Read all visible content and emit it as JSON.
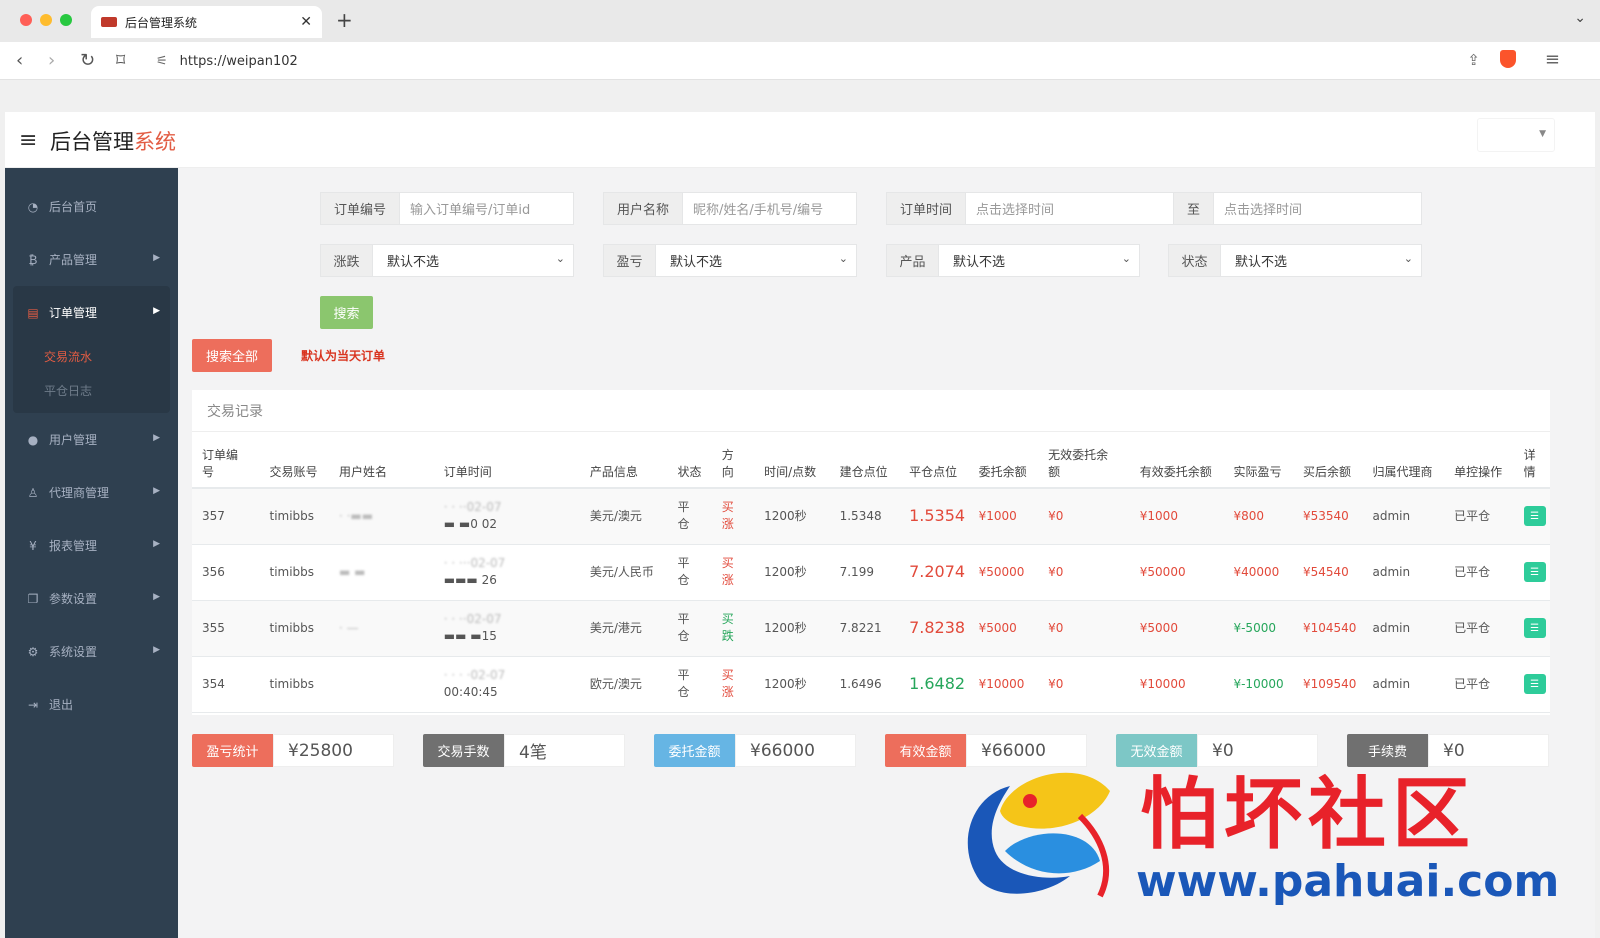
{
  "browser": {
    "tab_title": "后台管理系统",
    "url": "https://weipan102"
  },
  "app": {
    "brand_main": "后台管理",
    "brand_accent": "系统"
  },
  "sidebar": {
    "items": [
      {
        "label": "后台首页",
        "icon": "dashboard-icon"
      },
      {
        "label": "产品管理",
        "icon": "bitcoin-icon"
      },
      {
        "label": "订单管理",
        "icon": "orders-icon"
      },
      {
        "label": "用户管理",
        "icon": "user-icon"
      },
      {
        "label": "代理商管理",
        "icon": "agent-icon"
      },
      {
        "label": "报表管理",
        "icon": "yen-icon"
      },
      {
        "label": "参数设置",
        "icon": "copy-icon"
      },
      {
        "label": "系统设置",
        "icon": "gears-icon"
      },
      {
        "label": "退出",
        "icon": "logout-icon"
      }
    ],
    "sub_items": [
      "交易流水",
      "平仓日志"
    ]
  },
  "filters": {
    "order_no_label": "订单编号",
    "order_no_placeholder": "输入订单编号/订单id",
    "username_label": "用户名称",
    "username_placeholder": "昵称/姓名/手机号/编号",
    "order_time_label": "订单时间",
    "time_from_placeholder": "点击选择时间",
    "time_to_label": "至",
    "time_to_placeholder": "点击选择时间",
    "rise_label": "涨跌",
    "pnl_label": "盈亏",
    "product_label": "产品",
    "status_label": "状态",
    "default_option": "默认不选",
    "search_button": "搜索",
    "search_all_button": "搜索全部",
    "default_note": "默认为当天订单"
  },
  "table": {
    "title": "交易记录",
    "headers": [
      "订单编号",
      "交易账号",
      "用户姓名",
      "订单时间",
      "产品信息",
      "状态",
      "方向",
      "时间/点数",
      "建仓点位",
      "平仓点位",
      "委托余额",
      "无效委托余额",
      "有效委托余额",
      "实际盈亏",
      "买后余额",
      "归属代理商",
      "单控操作",
      "详情"
    ],
    "rows": [
      {
        "id": "357",
        "account": "timibbs",
        "name": "· ·▬▬",
        "time1": "· · ··02-07",
        "time2": "▬ ▬0 02",
        "product": "美元/澳元",
        "status": "平仓",
        "direction": "买涨",
        "dir_color": "red",
        "duration": "1200秒",
        "open": "1.5348",
        "close": "1.5354",
        "close_color": "red",
        "entrust": "¥1000",
        "invalid": "¥0",
        "valid": "¥1000",
        "pnl": "¥800",
        "pnl_color": "red",
        "balance": "¥53540",
        "agent": "admin",
        "op": "已平仓"
      },
      {
        "id": "356",
        "account": "timibbs",
        "name": "▬ ▬",
        "time1": "· · ···02-07",
        "time2": "▬▬▬ 26",
        "product": "美元/人民币",
        "status": "平仓",
        "direction": "买涨",
        "dir_color": "red",
        "duration": "1200秒",
        "open": "7.199",
        "close": "7.2074",
        "close_color": "red",
        "entrust": "¥50000",
        "invalid": "¥0",
        "valid": "¥50000",
        "pnl": "¥40000",
        "pnl_color": "red",
        "balance": "¥54540",
        "agent": "admin",
        "op": "已平仓"
      },
      {
        "id": "355",
        "account": "timibbs",
        "name": "· —",
        "time1": "· · ··02-07",
        "time2": "▬▬ ▬15",
        "product": "美元/港元",
        "status": "平仓",
        "direction": "买跌",
        "dir_color": "green",
        "duration": "1200秒",
        "open": "7.8221",
        "close": "7.8238",
        "close_color": "red",
        "entrust": "¥5000",
        "invalid": "¥0",
        "valid": "¥5000",
        "pnl": "¥-5000",
        "pnl_color": "green",
        "balance": "¥104540",
        "agent": "admin",
        "op": "已平仓"
      },
      {
        "id": "354",
        "account": "timibbs",
        "name": "",
        "time1": "· · · ·02-07",
        "time2": "00:40:45",
        "product": "欧元/澳元",
        "status": "平仓",
        "direction": "买涨",
        "dir_color": "red",
        "duration": "1200秒",
        "open": "1.6496",
        "close": "1.6482",
        "close_color": "green",
        "entrust": "¥10000",
        "invalid": "¥0",
        "valid": "¥10000",
        "pnl": "¥-10000",
        "pnl_color": "green",
        "balance": "¥109540",
        "agent": "admin",
        "op": "已平仓"
      }
    ]
  },
  "stats": [
    {
      "label": "盈亏统计",
      "value": "¥25800",
      "color": "#ed6e5c"
    },
    {
      "label": "交易手数",
      "value": "4笔",
      "color": "#707070"
    },
    {
      "label": "委托金额",
      "value": "¥66000",
      "color": "#66b5e4"
    },
    {
      "label": "有效金额",
      "value": "¥66000",
      "color": "#ed6e5c"
    },
    {
      "label": "无效金额",
      "value": "¥0",
      "color": "#7dc7c6"
    },
    {
      "label": "手续费",
      "value": "¥0",
      "color": "#707070"
    }
  ],
  "watermark": {
    "cn": "怕坏社区",
    "url": "www.pahuai.com"
  },
  "colors": {
    "sidebar_bg": "#2f4050",
    "accent_red": "#e25c43",
    "search_green": "#8bc66e"
  }
}
